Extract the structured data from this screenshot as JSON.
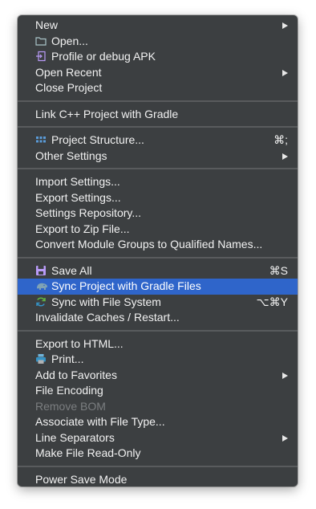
{
  "menu": {
    "groups": [
      {
        "items": [
          {
            "label": "New",
            "icon": "",
            "shortcut": "",
            "submenu": true
          },
          {
            "label": "Open...",
            "icon": "folder-icon",
            "shortcut": "",
            "submenu": false
          },
          {
            "label": "Profile or debug APK",
            "icon": "apk-import-icon",
            "shortcut": "",
            "submenu": false
          },
          {
            "label": "Open Recent",
            "icon": "",
            "shortcut": "",
            "submenu": true
          },
          {
            "label": "Close Project",
            "icon": "",
            "shortcut": "",
            "submenu": false
          }
        ]
      },
      {
        "items": [
          {
            "label": "Link C++ Project with Gradle",
            "icon": "",
            "shortcut": "",
            "submenu": false
          }
        ]
      },
      {
        "items": [
          {
            "label": "Project Structure...",
            "icon": "grid-icon",
            "shortcut": "⌘;",
            "submenu": false
          },
          {
            "label": "Other Settings",
            "icon": "",
            "shortcut": "",
            "submenu": true
          }
        ]
      },
      {
        "items": [
          {
            "label": "Import Settings...",
            "icon": "",
            "shortcut": "",
            "submenu": false
          },
          {
            "label": "Export Settings...",
            "icon": "",
            "shortcut": "",
            "submenu": false
          },
          {
            "label": "Settings Repository...",
            "icon": "",
            "shortcut": "",
            "submenu": false
          },
          {
            "label": "Export to Zip File...",
            "icon": "",
            "shortcut": "",
            "submenu": false
          },
          {
            "label": "Convert Module Groups to Qualified Names...",
            "icon": "",
            "shortcut": "",
            "submenu": false
          }
        ]
      },
      {
        "items": [
          {
            "label": "Save All",
            "icon": "save-icon",
            "shortcut": "⌘S",
            "submenu": false
          },
          {
            "label": "Sync Project with Gradle Files",
            "icon": "gradle-elephant-icon",
            "shortcut": "",
            "submenu": false,
            "highlighted": true
          },
          {
            "label": "Sync with File System",
            "icon": "sync-icon",
            "shortcut": "⌥⌘Y",
            "submenu": false
          },
          {
            "label": "Invalidate Caches / Restart...",
            "icon": "",
            "shortcut": "",
            "submenu": false
          }
        ]
      },
      {
        "items": [
          {
            "label": "Export to HTML...",
            "icon": "",
            "shortcut": "",
            "submenu": false
          },
          {
            "label": "Print...",
            "icon": "printer-icon",
            "shortcut": "",
            "submenu": false
          },
          {
            "label": "Add to Favorites",
            "icon": "",
            "shortcut": "",
            "submenu": true
          },
          {
            "label": "File Encoding",
            "icon": "",
            "shortcut": "",
            "submenu": false
          },
          {
            "label": "Remove BOM",
            "icon": "",
            "shortcut": "",
            "submenu": false,
            "disabled": true
          },
          {
            "label": "Associate with File Type...",
            "icon": "",
            "shortcut": "",
            "submenu": false
          },
          {
            "label": "Line Separators",
            "icon": "",
            "shortcut": "",
            "submenu": true
          },
          {
            "label": "Make File Read-Only",
            "icon": "",
            "shortcut": "",
            "submenu": false
          }
        ]
      },
      {
        "items": [
          {
            "label": "Power Save Mode",
            "icon": "",
            "shortcut": "",
            "submenu": false
          }
        ]
      }
    ],
    "colors": {
      "background": "#3c3f41",
      "highlight": "#2f65ca",
      "text": "#f2f2f2",
      "disabled_text": "#7b7e80",
      "separator": "#595b5d"
    }
  }
}
